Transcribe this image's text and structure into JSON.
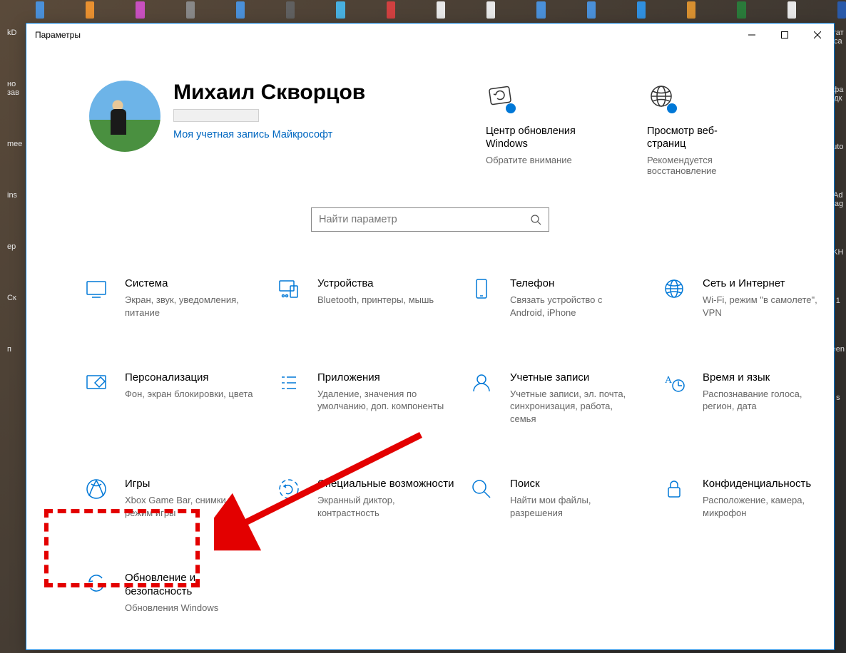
{
  "window": {
    "title": "Параметры",
    "user": {
      "name": "Михаил Скворцов",
      "account_link": "Моя учетная запись Майкрософт"
    },
    "header_cards": [
      {
        "icon": "update-icon",
        "title": "Центр обновления Windows",
        "sub": "Обратите внимание"
      },
      {
        "icon": "globe-icon",
        "title": "Просмотр веб-страниц",
        "sub": "Рекомендуется восстановление"
      }
    ],
    "search": {
      "placeholder": "Найти параметр"
    },
    "tiles": [
      {
        "icon": "system",
        "title": "Система",
        "desc": "Экран, звук, уведомления, питание"
      },
      {
        "icon": "devices",
        "title": "Устройства",
        "desc": "Bluetooth, принтеры, мышь"
      },
      {
        "icon": "phone",
        "title": "Телефон",
        "desc": "Связать устройство с Android, iPhone"
      },
      {
        "icon": "network",
        "title": "Сеть и Интернет",
        "desc": "Wi-Fi, режим \"в самолете\", VPN"
      },
      {
        "icon": "personalization",
        "title": "Персонализация",
        "desc": "Фон, экран блокировки, цвета"
      },
      {
        "icon": "apps",
        "title": "Приложения",
        "desc": "Удаление, значения по умолчанию, доп. компоненты"
      },
      {
        "icon": "accounts",
        "title": "Учетные записи",
        "desc": "Учетные записи, эл. почта, синхронизация, работа, семья"
      },
      {
        "icon": "time",
        "title": "Время и язык",
        "desc": "Распознавание голоса, регион, дата"
      },
      {
        "icon": "gaming",
        "title": "Игры",
        "desc": "Xbox Game Bar, снимки, режим игры"
      },
      {
        "icon": "access",
        "title": "Специальные возможности",
        "desc": "Экранный диктор, контрастность"
      },
      {
        "icon": "search",
        "title": "Поиск",
        "desc": "Найти мои файлы, разрешения"
      },
      {
        "icon": "privacy",
        "title": "Конфиденциальность",
        "desc": "Расположение, камера, микрофон"
      },
      {
        "icon": "update",
        "title": "Обновление и безопасность",
        "desc": "Обновления Windows"
      }
    ]
  },
  "desktop_labels": {
    "left": [
      "kD",
      "но\nзав",
      "mee",
      "ins",
      "ep",
      "Ск",
      "п"
    ],
    "right": [
      "тат\nса",
      "фа\nдк",
      "uto",
      "Ad\nlag",
      "KH",
      "1",
      "een",
      "s"
    ]
  },
  "accent": "#0078d7",
  "arrow_color": "#e30000"
}
